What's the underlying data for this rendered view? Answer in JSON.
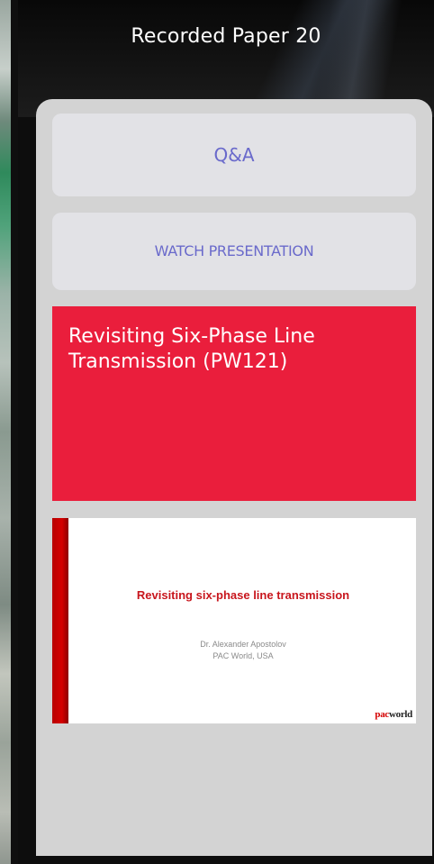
{
  "header": {
    "title": "Recorded Paper 20"
  },
  "actions": {
    "qa_label": "Q&A",
    "watch_label": "WATCH PRESENTATION"
  },
  "paper": {
    "title": "Revisiting Six-Phase Line Transmission (PW121)"
  },
  "thumbnail": {
    "slide_title": "Revisiting six-phase line transmission",
    "author": "Dr. Alexander Apostolov",
    "organization": "PAC World, USA",
    "logo_pac": "pac",
    "logo_world": "world"
  },
  "colors": {
    "title_card": "#ea1e3c",
    "button_text": "#6a6acb",
    "panel": "#d3d3d3",
    "button_bg": "#e2e2e6"
  }
}
